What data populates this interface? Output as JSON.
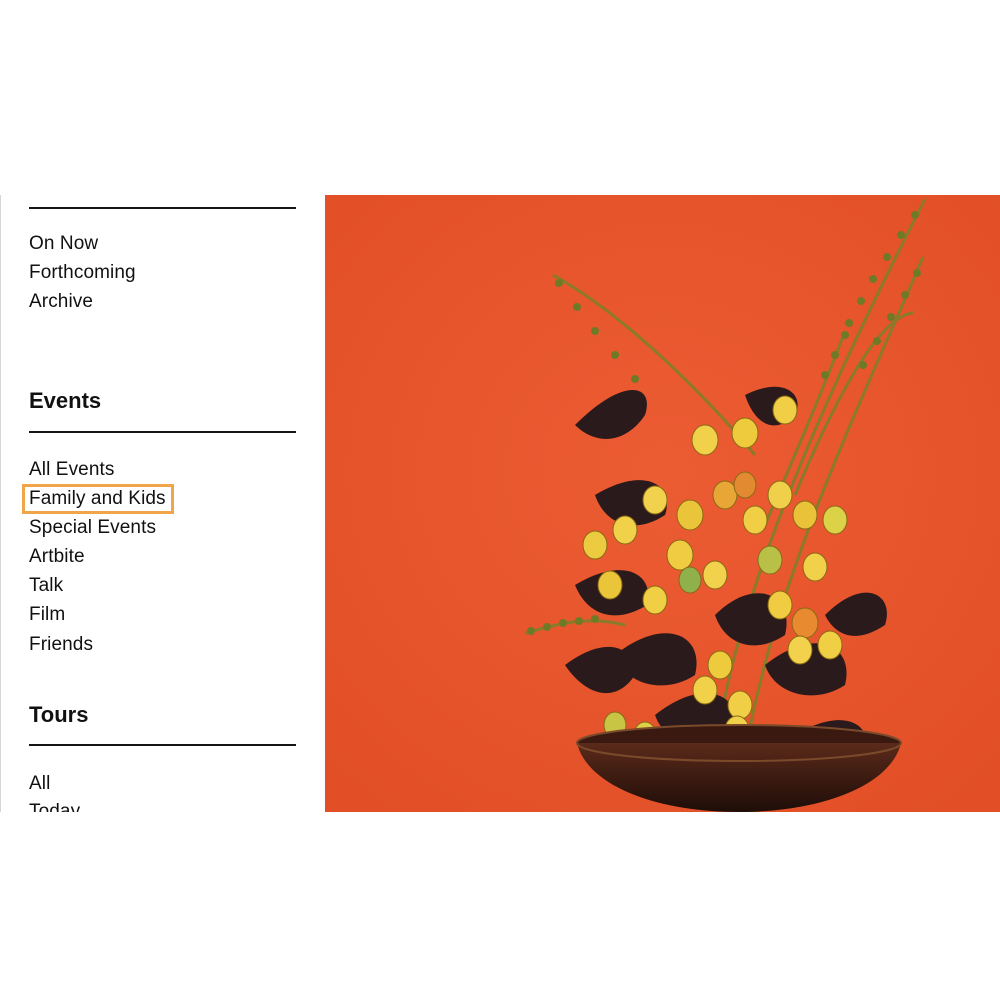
{
  "nav": {
    "exhibitions": [
      "On Now",
      "Forthcoming",
      "Archive"
    ],
    "events": {
      "heading": "Events",
      "items": [
        "All Events",
        "Family and Kids",
        "Special Events",
        "Artbite",
        "Talk",
        "Film",
        "Friends"
      ]
    },
    "tours": {
      "heading": "Tours",
      "items": [
        "All",
        "Today"
      ]
    }
  },
  "hero": {
    "background_color": "#e8552c"
  },
  "highlight": {
    "color": "#f0a54a",
    "target": "Family and Kids"
  }
}
